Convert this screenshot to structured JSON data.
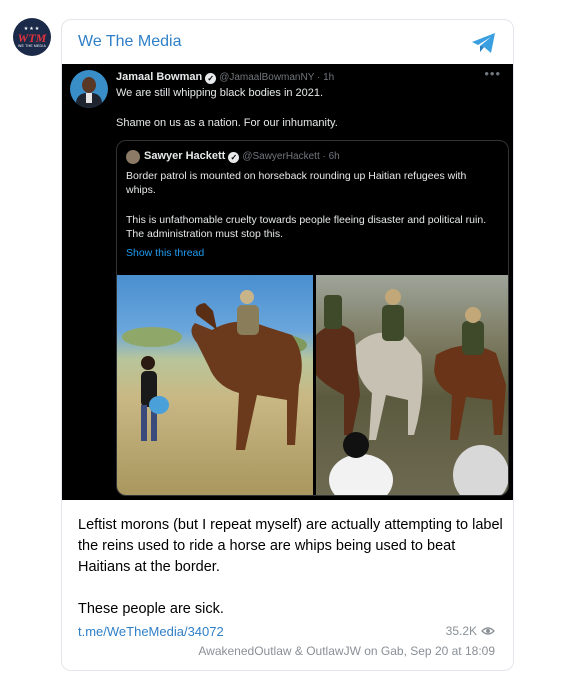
{
  "channel": {
    "name": "We The Media",
    "avatar": {
      "initials": "WTM",
      "subtitle": "WE THE MEDIA",
      "stars": "★★★"
    }
  },
  "tweet": {
    "author": "Jamaal Bowman",
    "handle": "@JamaalBowmanNY · 1h",
    "line1": "We are still whipping black bodies in 2021.",
    "line2": "Shame on us as a nation. For our inhumanity.",
    "more": "•••",
    "quote": {
      "author": "Sawyer Hackett",
      "handle": "@SawyerHackett · 6h",
      "para1": "Border patrol is mounted on horseback rounding up Haitian refugees with whips.",
      "para2": "This is unfathomable cruelty towards people fleeing disaster and political ruin. The administration must stop this.",
      "link": "Show this thread"
    }
  },
  "post": {
    "paragraph1": "Leftist morons (but I repeat myself) are actually attempting to label the reins used to ride a horse are whips being used to beat Haitians at the border.",
    "paragraph2": "These people are sick.",
    "link": "t.me/WeTheMedia/34072",
    "views": "35.2K",
    "signature": "AwakenedOutlaw & OutlawJW on Gab, Sep 20 at 18:09"
  },
  "colors": {
    "accent": "#2f7fc7",
    "meta": "#8a9096",
    "tweet_bg": "#000000",
    "tweet_text": "#e7e9ea",
    "tweet_link": "#1d9bf0"
  },
  "icons": [
    "telegram-share-icon",
    "verified-icon",
    "eye-icon",
    "more-icon"
  ]
}
